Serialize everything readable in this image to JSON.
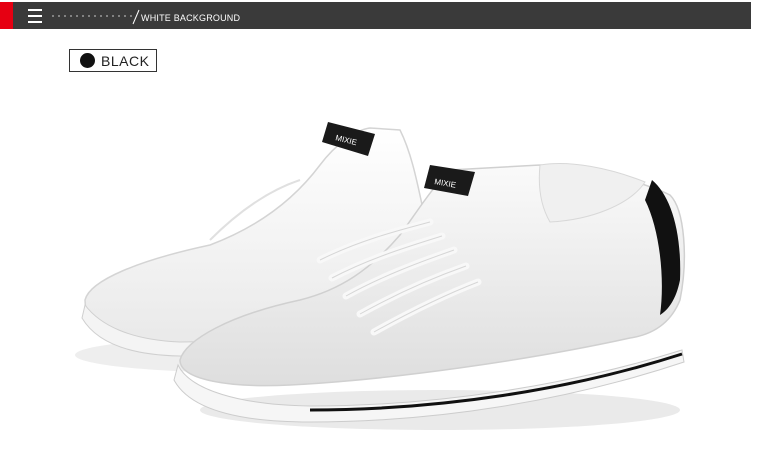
{
  "header": {
    "title": "WHITE BACKGROUND",
    "menu_icon": "menu-icon",
    "accent_color": "#e60012",
    "bar_color": "#3a3a3a"
  },
  "variant": {
    "label": "BLACK",
    "swatch_color": "#111111"
  },
  "product_image": {
    "tongue_label_text": "MIXIE"
  }
}
